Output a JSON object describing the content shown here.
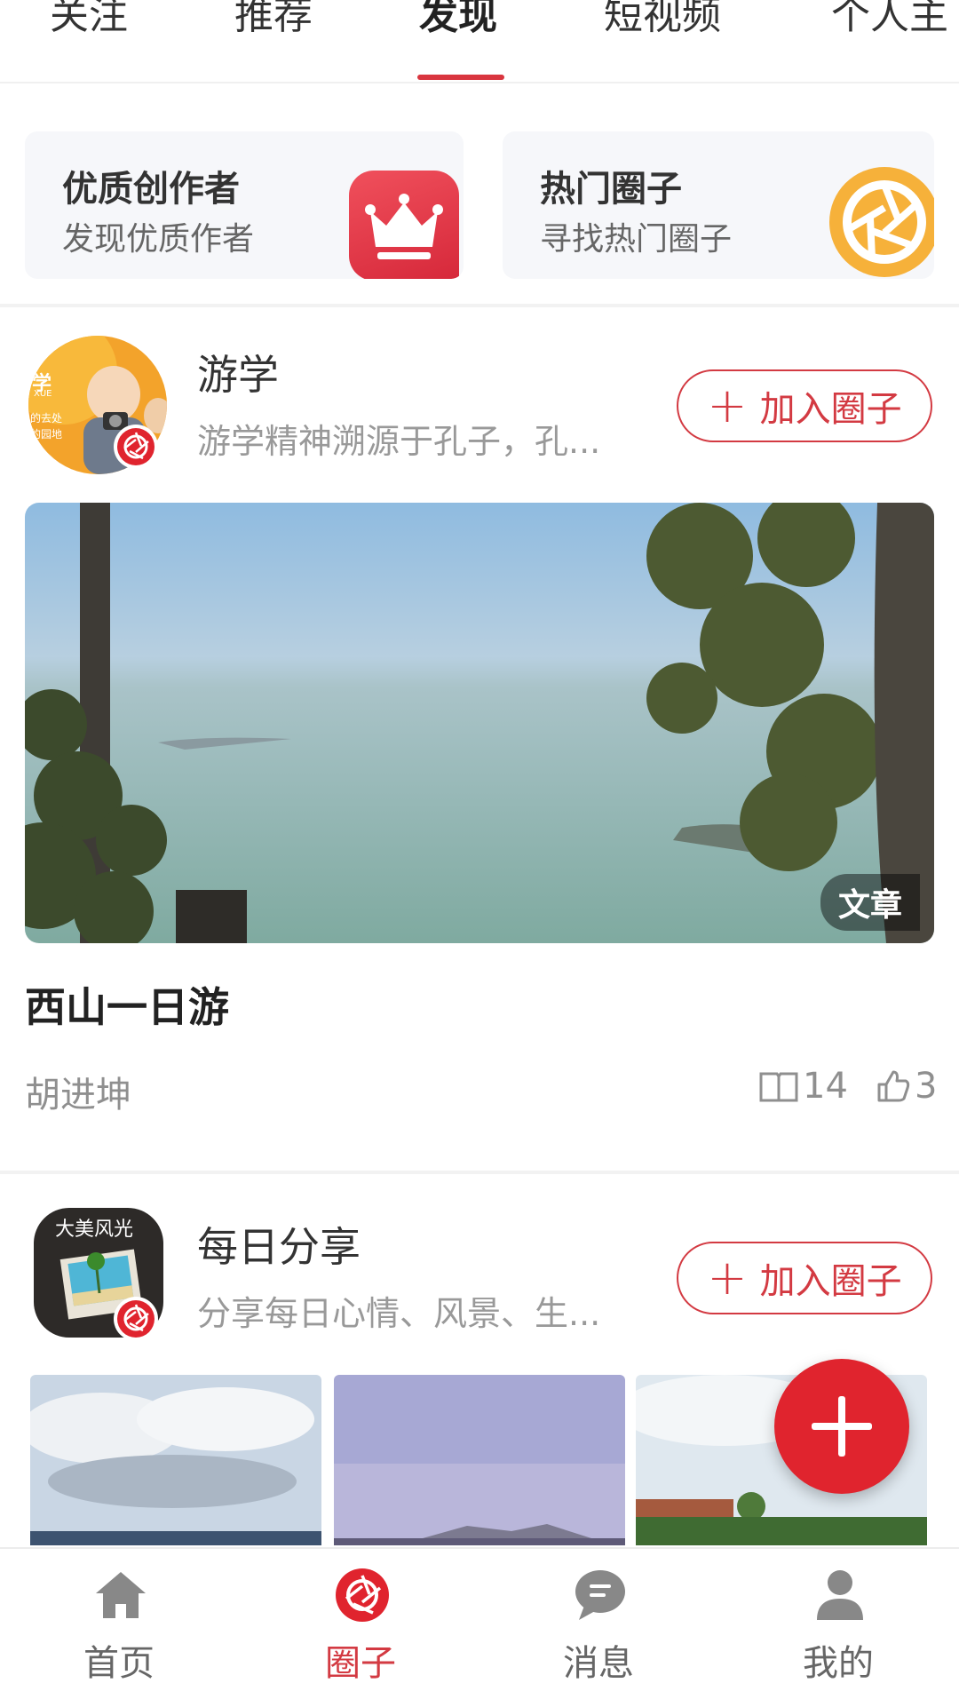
{
  "top_tabs": [
    "关注",
    "推荐",
    "发现",
    "短视频",
    "个人主"
  ],
  "active_tab": "发现",
  "features": [
    {
      "title": "优质创作者",
      "subtitle": "发现优质作者",
      "icon": "crown-icon"
    },
    {
      "title": "热门圈子",
      "subtitle": "寻找热门圈子",
      "icon": "aperture-icon"
    }
  ],
  "circles": [
    {
      "name": "游学",
      "description": "游学精神溯源于孔子，孔...",
      "join_label": "加入圈子",
      "avatar_text": {
        "line1": "学",
        "line2": "XUE",
        "line3": "的去处",
        "line4": "的园地"
      }
    },
    {
      "name": "每日分享",
      "description": "分享每日心情、风景、生...",
      "join_label": "加入圈子",
      "avatar_text": {
        "line1": "大美风光"
      }
    }
  ],
  "article": {
    "tag": "文章",
    "title": "西山一日游",
    "author": "胡进坤",
    "reads": "14",
    "likes": "3"
  },
  "bottom_nav": [
    {
      "label": "首页",
      "icon": "home-icon",
      "active": false
    },
    {
      "label": "圈子",
      "icon": "aperture-icon",
      "active": true
    },
    {
      "label": "消息",
      "icon": "chat-icon",
      "active": false
    },
    {
      "label": "我的",
      "icon": "user-icon",
      "active": false
    }
  ],
  "colors": {
    "accent": "#d33a42",
    "fab": "#e0242e",
    "text": "#333333",
    "muted": "#999999"
  }
}
